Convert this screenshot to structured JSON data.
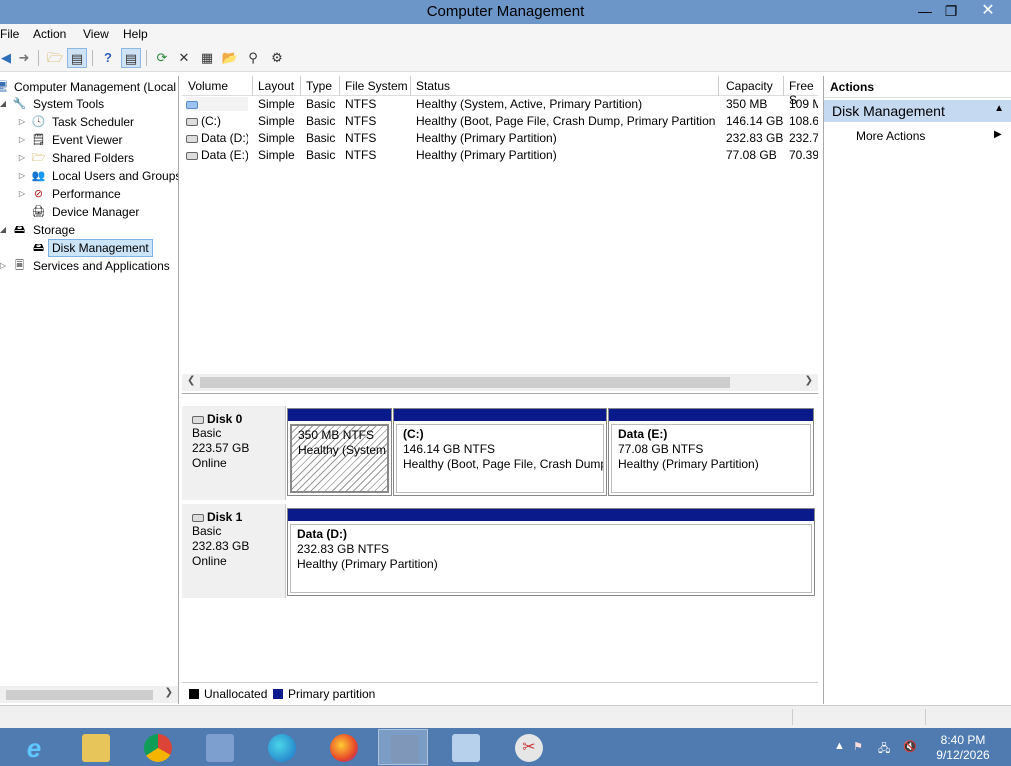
{
  "window": {
    "title": "Computer Management",
    "min": "—",
    "max": "❐",
    "close": "✕"
  },
  "menu": [
    "File",
    "Action",
    "View",
    "Help"
  ],
  "toolbar": {
    "icons": [
      "back-icon",
      "forward-icon",
      "up-folder-icon",
      "show-hide-tree-icon",
      "help-icon",
      "show-hide-action-pane-icon",
      "refresh-icon",
      "delete-icon",
      "properties-icon",
      "open-icon",
      "search-icon",
      "settings-icon"
    ]
  },
  "tree": {
    "items": [
      {
        "label": "Computer Management (Local",
        "level": 0,
        "expanded": true
      },
      {
        "label": "System Tools",
        "level": 1,
        "expanded": true
      },
      {
        "label": "Task Scheduler",
        "level": 2,
        "expanded": false
      },
      {
        "label": "Event Viewer",
        "level": 2,
        "expanded": false
      },
      {
        "label": "Shared Folders",
        "level": 2,
        "expanded": false
      },
      {
        "label": "Local Users and Groups",
        "level": 2,
        "expanded": false
      },
      {
        "label": "Performance",
        "level": 2,
        "expanded": false
      },
      {
        "label": "Device Manager",
        "level": 2,
        "expanded": null
      },
      {
        "label": "Storage",
        "level": 1,
        "expanded": true
      },
      {
        "label": "Disk Management",
        "level": 2,
        "expanded": null,
        "selected": true
      },
      {
        "label": "Services and Applications",
        "level": 1,
        "expanded": false
      }
    ]
  },
  "volumes": {
    "columns": [
      "Volume",
      "Layout",
      "Type",
      "File System",
      "Status",
      "Capacity",
      "Free S"
    ],
    "rows": [
      {
        "volume": "",
        "layout": "Simple",
        "type": "Basic",
        "fs": "NTFS",
        "status": "Healthy (System, Active, Primary Partition)",
        "capacity": "350 MB",
        "free": "109 M"
      },
      {
        "volume": "(C:)",
        "layout": "Simple",
        "type": "Basic",
        "fs": "NTFS",
        "status": "Healthy (Boot, Page File, Crash Dump, Primary Partition)",
        "capacity": "146.14 GB",
        "free": "108.6"
      },
      {
        "volume": "Data (D:)",
        "layout": "Simple",
        "type": "Basic",
        "fs": "NTFS",
        "status": "Healthy (Primary Partition)",
        "capacity": "232.83 GB",
        "free": "232.7"
      },
      {
        "volume": "Data (E:)",
        "layout": "Simple",
        "type": "Basic",
        "fs": "NTFS",
        "status": "Healthy (Primary Partition)",
        "capacity": "77.08 GB",
        "free": "70.39"
      }
    ]
  },
  "disks": [
    {
      "name": "Disk 0",
      "kind": "Basic",
      "size": "223.57 GB",
      "state": "Online",
      "partitions": [
        {
          "name": "",
          "size": "350 MB NTFS",
          "status": "Healthy (System, Active, Primary Partition)",
          "hatched": true
        },
        {
          "name": "(C:)",
          "size": "146.14 GB NTFS",
          "status": "Healthy (Boot, Page File, Crash Dump, Primary Partition)",
          "hatched": false
        },
        {
          "name": "Data  (E:)",
          "size": "77.08 GB NTFS",
          "status": "Healthy (Primary Partition)",
          "hatched": false
        }
      ]
    },
    {
      "name": "Disk 1",
      "kind": "Basic",
      "size": "232.83 GB",
      "state": "Online",
      "partitions": [
        {
          "name": "Data  (D:)",
          "size": "232.83 GB NTFS",
          "status": "Healthy (Primary Partition)",
          "hatched": false
        }
      ]
    }
  ],
  "legend": [
    {
      "label": "Unallocated",
      "color": "#000000"
    },
    {
      "label": "Primary partition",
      "color": "#0a1a8a"
    }
  ],
  "actions": {
    "header": "Actions",
    "section": "Disk Management",
    "item": "More Actions"
  },
  "taskbar": {
    "apps": [
      "internet-explorer-icon",
      "file-explorer-icon",
      "chrome-icon",
      "network-icon",
      "edge-icon",
      "firefox-icon",
      "computer-management-icon",
      "control-panel-icon",
      "snipping-tool-icon"
    ],
    "time": "8:40 PM",
    "date": "9/12/2026"
  },
  "colors": {
    "titlebar": "#6c96c8",
    "taskbar": "#4f7bb0",
    "partition_bar": "#0a1a8a",
    "selection": "#cce4f7",
    "actions_section": "#c5d9f1"
  }
}
